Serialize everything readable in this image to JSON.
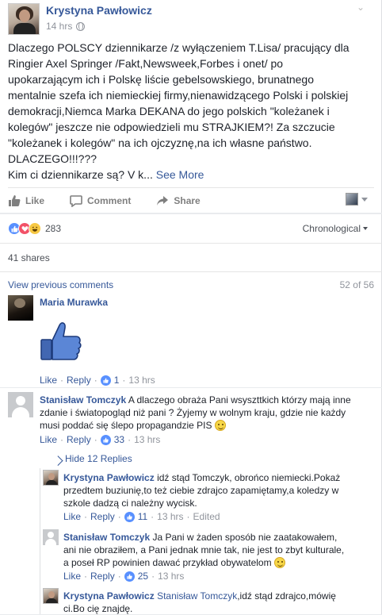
{
  "post": {
    "author": "Krystyna Pawłowicz",
    "time": "14 hrs",
    "text": "Dlaczego POLSCY dziennikarze /z wyłączeniem T.Lisa/ pracujący dla\nRingier Axel Springer /Fakt,Newsweek,Forbes i onet/ po\nupokarzającym ich i Polskę liście gebelsowskiego, brunatnego\nmentalnie szefa ich niemieckiej firmy,nienawidzącego Polski i polskiej\ndemokracji,Niemca Marka DEKANA do jego polskich \"koleżanek i\nkolegów\" jeszcze nie odpowiedzieli mu STRAJKIEM?! Za szczucie\n\"koleżanek i kolegów\" na ich ojczyznę,na ich własne państwo.\nDLACZEGO!!!???\nKim ci dziennikarze są? V k...",
    "see_more": "See More"
  },
  "actions": {
    "like": "Like",
    "comment": "Comment",
    "share": "Share"
  },
  "reactions": {
    "count": "283",
    "order": "Chronological"
  },
  "shares": "41 shares",
  "previous": {
    "label": "View previous comments",
    "counter": "52 of 56"
  },
  "comments": [
    {
      "author": "Maria Murawka",
      "text": "",
      "like": "Like",
      "reply": "Reply",
      "likes": "1",
      "time": "13 hrs",
      "sticker": "thumbs-up"
    },
    {
      "author": "Stanisław Tomczyk",
      "text": "A dlaczego obraża Pani wsyszttkich którzy mają inne zdanie i światopogląd niż pani ? Żyjemy w wolnym kraju, gdzie nie każdy musi poddać się ślepo propagandzie PIS",
      "like": "Like",
      "reply": "Reply",
      "likes": "33",
      "time": "13 hrs"
    }
  ],
  "hide_replies": "Hide 12 Replies",
  "replies": [
    {
      "author": "Krystyna Pawłowicz",
      "text": "idź stąd Tomczyk, obrońco niemiecki.Pokaż przedtem buziunię,to też ciebie zdrajco zapamiętamy,a koledzy w szkole dadzą ci należny wycisk.",
      "like": "Like",
      "reply": "Reply",
      "likes": "11",
      "time": "13 hrs",
      "edited": "Edited"
    },
    {
      "author": "Stanisław Tomczyk",
      "text": "Ja Pani w żaden sposób nie zaatakowałem, ani nie obraziłem, a Pani jednak mnie tak, nie jest to zbyt kulturale, a poseł RP powinien dawać przykład obywatelom",
      "like": "Like",
      "reply": "Reply",
      "likes": "25",
      "time": "13 hrs"
    },
    {
      "author": "Krystyna Pawłowicz",
      "mention": "Stanisław Tomczyk",
      "text": ",idź stąd zdrajco,mówię ci.Bo cię znajdę."
    }
  ],
  "colors": {
    "link": "#365899",
    "like_blue": "#5890ff",
    "love_red": "#f25268",
    "haha_yellow": "#f7c844",
    "thumb_blue": "#4267b2"
  }
}
